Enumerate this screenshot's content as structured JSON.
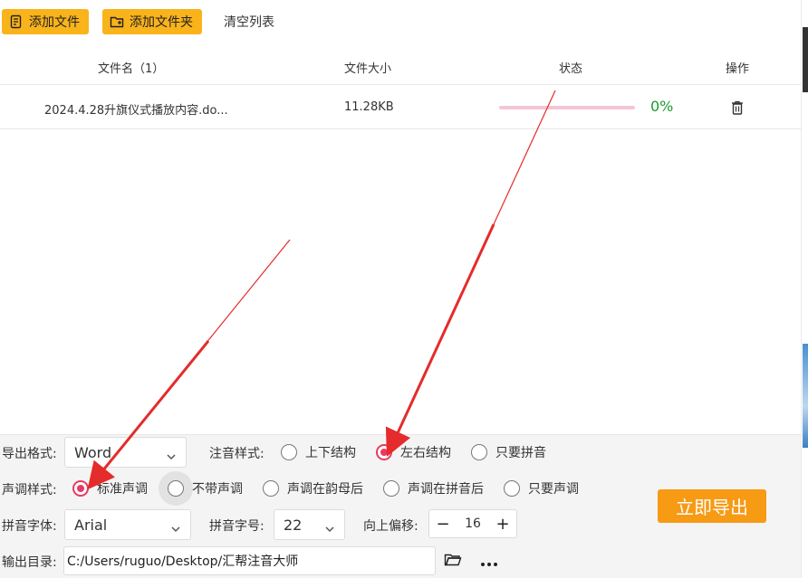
{
  "toolbar": {
    "add_file": "添加文件",
    "add_folder": "添加文件夹",
    "clear_list": "清空列表"
  },
  "table": {
    "headers": {
      "name": "文件名（1）",
      "size": "文件大小",
      "status": "状态",
      "action": "操作"
    },
    "rows": [
      {
        "name": "2024.4.28升旗仪式播放内容.do...",
        "size": "11.28KB",
        "progress": 0,
        "progress_text": "0%"
      }
    ]
  },
  "settings": {
    "export_format": {
      "label": "导出格式:",
      "value": "Word"
    },
    "annotation_style": {
      "label": "注音样式:",
      "options": [
        "上下结构",
        "左右结构",
        "只要拼音"
      ],
      "selected": 1
    },
    "tone_style": {
      "label": "声调样式:",
      "options": [
        "标准声调",
        "不带声调",
        "声调在韵母后",
        "声调在拼音后",
        "只要声调"
      ],
      "selected": 0
    },
    "pinyin_font": {
      "label": "拼音字体:",
      "value": "Arial"
    },
    "pinyin_size": {
      "label": "拼音字号:",
      "value": "22"
    },
    "offset": {
      "label": "向上偏移:",
      "value": "16",
      "minus": "−",
      "plus": "+"
    },
    "output_dir": {
      "label": "输出目录:",
      "value": "C:/Users/ruguo/Desktop/汇帮注音大师"
    }
  },
  "export_button": "立即导出",
  "colors": {
    "accent_yellow": "#f9b31b",
    "export_orange": "#f79a14",
    "radio_pink": "#e83a62",
    "progress_green": "#1a9b2e",
    "arrow_red": "#e52b2b"
  },
  "icons": {
    "add_file": "file-list-icon",
    "add_folder": "folder-plus-icon",
    "delete": "trash-icon",
    "browse": "folder-open-icon",
    "more": "ellipsis-icon",
    "dropdown": "chevron-down-icon"
  }
}
